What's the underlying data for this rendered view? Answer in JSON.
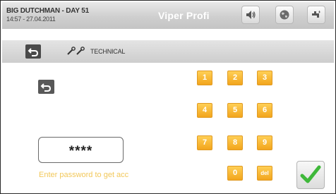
{
  "header": {
    "title": "BIG DUTCHMAN - DAY 51",
    "datetime": "14:57 - 27.04.2011",
    "product": "Viper Profi",
    "icons": [
      "speaker-icon",
      "globe-icon",
      "faucet-icon"
    ]
  },
  "nav": {
    "back_icon": "back-arrow-icon",
    "section_icon": "wrench-icon",
    "section_label": "TECHNICAL"
  },
  "keypad": {
    "keys": [
      "1",
      "2",
      "3",
      "4",
      "5",
      "6",
      "7",
      "8",
      "9",
      "0",
      "del"
    ],
    "key_color": "#f4a91e"
  },
  "password": {
    "masked_value": "****",
    "hint": "Enter password to get acc"
  },
  "confirm": {
    "icon": "checkmark-icon",
    "color": "#3fb83a"
  }
}
